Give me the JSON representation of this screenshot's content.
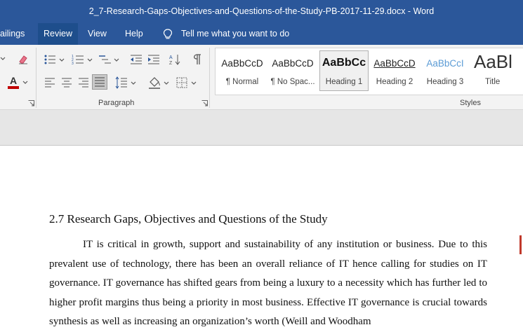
{
  "window": {
    "title": "2_7-Research-Gaps-Objectives-and-Questions-of-the-Study-PB-2017-11-29.docx  -  Word"
  },
  "menu": {
    "tabs": [
      "ailings",
      "Review",
      "View",
      "Help"
    ],
    "active_tab": "Review",
    "tell_me": "Tell me what you want to do"
  },
  "ribbon": {
    "paragraph_label": "Paragraph",
    "styles_label": "Styles",
    "styles": [
      {
        "sample": "AaBbCcD",
        "name": "¶ Normal"
      },
      {
        "sample": "AaBbCcD",
        "name": "¶ No Spac..."
      },
      {
        "sample": "AaBbCc",
        "name": "Heading 1"
      },
      {
        "sample": "AaBbCcD",
        "name": "Heading 2"
      },
      {
        "sample": "AaBbCcI",
        "name": "Heading 3"
      },
      {
        "sample": "AaBl",
        "name": "Title"
      }
    ],
    "selected_style": "Heading 1"
  },
  "colors": {
    "titlebar": "#2b579a",
    "font_color_bar": "#c00000",
    "heading3_blue": "#5b9bd5"
  },
  "document": {
    "heading": "2.7 Research Gaps, Objectives and Questions of the Study",
    "paragraph": "IT is critical in growth, support and sustainability of any institution or business. Due to this prevalent use of technology, there has been an overall reliance of IT hence calling for studies on IT governance. IT governance has shifted gears from being a luxury to a necessity which has further led to higher profit margins thus being a priority in most business. Effective IT governance is crucial towards synthesis as well as increasing an organization’s worth (Weill and Woodham"
  }
}
